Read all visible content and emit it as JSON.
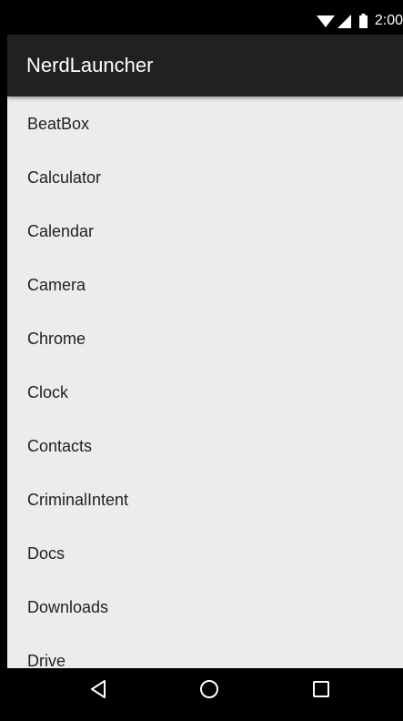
{
  "status_bar": {
    "time": "2:00",
    "icons": [
      "wifi-icon",
      "signal-icon",
      "battery-icon"
    ]
  },
  "app_bar": {
    "title": "NerdLauncher"
  },
  "apps": [
    {
      "label": "BeatBox"
    },
    {
      "label": "Calculator"
    },
    {
      "label": "Calendar"
    },
    {
      "label": "Camera"
    },
    {
      "label": "Chrome"
    },
    {
      "label": "Clock"
    },
    {
      "label": "Contacts"
    },
    {
      "label": "CriminalIntent"
    },
    {
      "label": "Docs"
    },
    {
      "label": "Downloads"
    },
    {
      "label": "Drive"
    }
  ],
  "nav_bar": {
    "icons": [
      "back-icon",
      "home-icon",
      "recents-icon"
    ]
  },
  "colors": {
    "app_bar": "#212121",
    "list_background": "#ececec",
    "text": "#222222",
    "system_bars": "#000000"
  }
}
